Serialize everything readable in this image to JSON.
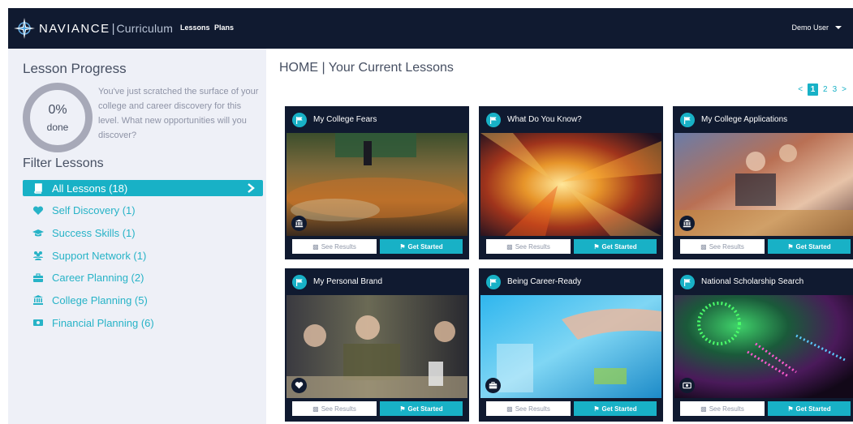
{
  "header": {
    "brand": "NAVIANCE",
    "brand_sub": "Curriculum",
    "nav": [
      {
        "label": "Lessons"
      },
      {
        "label": "Plans"
      }
    ],
    "user": "Demo User",
    "colors": {
      "bar": "#101a30",
      "accent": "#18b1c6"
    }
  },
  "sidebar": {
    "progress_title": "Lesson Progress",
    "progress_value": "0%",
    "progress_fraction": 0,
    "progress_label": "done",
    "progress_text": "You've just scratched the surface of your college and career discovery for this level. What new opportunities will you discover?",
    "filter_title": "Filter Lessons",
    "filters": [
      {
        "label": "All Lessons (18)",
        "icon": "book-icon",
        "active": true
      },
      {
        "label": "Self Discovery (1)",
        "icon": "heart-icon"
      },
      {
        "label": "Success Skills (1)",
        "icon": "graduation-cap-icon"
      },
      {
        "label": "Support Network (1)",
        "icon": "people-icon"
      },
      {
        "label": "Career Planning (2)",
        "icon": "briefcase-icon"
      },
      {
        "label": "College Planning (5)",
        "icon": "university-icon"
      },
      {
        "label": "Financial Planning (6)",
        "icon": "money-icon"
      }
    ]
  },
  "main": {
    "title": "HOME | Your Current Lessons",
    "pagination": {
      "prev": "<",
      "pages": [
        "1",
        "2",
        "3"
      ],
      "current": "1",
      "next": ">"
    },
    "results_label": "See Results",
    "start_label": "Get Started",
    "cards": [
      {
        "title": "My College Fears",
        "category_icon": "university-icon"
      },
      {
        "title": "What Do You Know?",
        "category_icon": ""
      },
      {
        "title": "My College Applications",
        "category_icon": "university-icon"
      },
      {
        "title": "My Personal Brand",
        "category_icon": "heart-icon"
      },
      {
        "title": "Being Career-Ready",
        "category_icon": "briefcase-icon"
      },
      {
        "title": "National Scholarship Search",
        "category_icon": "money-icon"
      }
    ]
  }
}
